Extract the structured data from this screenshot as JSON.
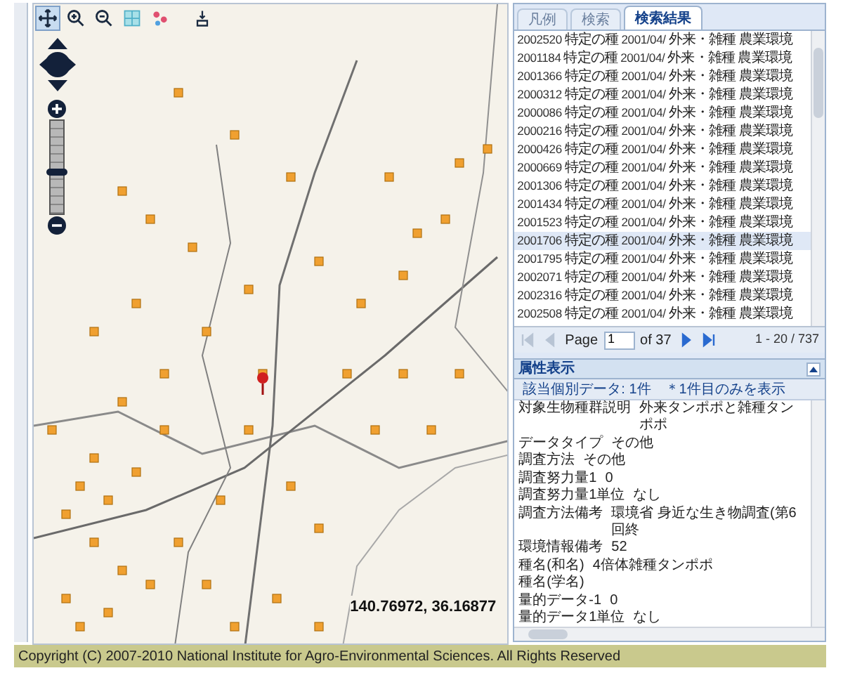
{
  "map_toolbar": {
    "tools": [
      {
        "kind": "pan",
        "selected": true
      },
      {
        "kind": "zoom_in",
        "selected": false
      },
      {
        "kind": "zoom_out",
        "selected": false
      },
      {
        "kind": "grid",
        "selected": false
      },
      {
        "kind": "points",
        "selected": false
      },
      {
        "kind": "print",
        "selected": false
      }
    ]
  },
  "zoom_slider": {
    "level": 0.45
  },
  "map": {
    "coordinates": "140.76972, 36.16877"
  },
  "tabs": [
    {
      "label": "凡例",
      "selected": false
    },
    {
      "label": "検索",
      "selected": false
    },
    {
      "label": "検索結果",
      "selected": true
    }
  ],
  "results": {
    "rows": [
      {
        "cells": [
          "2002520",
          "特定の種",
          "2001/04/",
          "外来・雑種",
          "農業環境"
        ],
        "selected": false
      },
      {
        "cells": [
          "2001184",
          "特定の種",
          "2001/04/",
          "外来・雑種",
          "農業環境"
        ],
        "selected": false
      },
      {
        "cells": [
          "2001366",
          "特定の種",
          "2001/04/",
          "外来・雑種",
          "農業環境"
        ],
        "selected": false
      },
      {
        "cells": [
          "2000312",
          "特定の種",
          "2001/04/",
          "外来・雑種",
          "農業環境"
        ],
        "selected": false
      },
      {
        "cells": [
          "2000086",
          "特定の種",
          "2001/04/",
          "外来・雑種",
          "農業環境"
        ],
        "selected": false
      },
      {
        "cells": [
          "2000216",
          "特定の種",
          "2001/04/",
          "外来・雑種",
          "農業環境"
        ],
        "selected": false
      },
      {
        "cells": [
          "2000426",
          "特定の種",
          "2001/04/",
          "外来・雑種",
          "農業環境"
        ],
        "selected": false
      },
      {
        "cells": [
          "2000669",
          "特定の種",
          "2001/04/",
          "外来・雑種",
          "農業環境"
        ],
        "selected": false
      },
      {
        "cells": [
          "2001306",
          "特定の種",
          "2001/04/",
          "外来・雑種",
          "農業環境"
        ],
        "selected": false
      },
      {
        "cells": [
          "2001434",
          "特定の種",
          "2001/04/",
          "外来・雑種",
          "農業環境"
        ],
        "selected": false
      },
      {
        "cells": [
          "2001523",
          "特定の種",
          "2001/04/",
          "外来・雑種",
          "農業環境"
        ],
        "selected": false
      },
      {
        "cells": [
          "2001706",
          "特定の種",
          "2001/04/",
          "外来・雑種",
          "農業環境"
        ],
        "selected": true
      },
      {
        "cells": [
          "2001795",
          "特定の種",
          "2001/04/",
          "外来・雑種",
          "農業環境"
        ],
        "selected": false
      },
      {
        "cells": [
          "2002071",
          "特定の種",
          "2001/04/",
          "外来・雑種",
          "農業環境"
        ],
        "selected": false
      },
      {
        "cells": [
          "2002316",
          "特定の種",
          "2001/04/",
          "外来・雑種",
          "農業環境"
        ],
        "selected": false
      },
      {
        "cells": [
          "2002508",
          "特定の種",
          "2001/04/",
          "外来・雑種",
          "農業環境"
        ],
        "selected": false
      }
    ]
  },
  "pager": {
    "buttons": [
      {
        "kind": "first",
        "disabled": true
      },
      {
        "kind": "prev",
        "disabled": true
      },
      {
        "kind": "next",
        "disabled": false
      },
      {
        "kind": "last",
        "disabled": false
      }
    ],
    "page_label": "Page",
    "page": "1",
    "of": "of 37",
    "range": "1 - 20 / 737"
  },
  "attributes": {
    "title": "属性表示",
    "summary": "該当個別データ: 1件",
    "note": "＊1件目のみを表示",
    "rows": [
      {
        "label": "対象生物種群説明",
        "value": "外来タンポポと雑種タンポポ"
      },
      {
        "label": "データタイプ",
        "value": "その他"
      },
      {
        "label": "調査方法",
        "value": "その他"
      },
      {
        "label": "調査努力量1",
        "value": "0"
      },
      {
        "label": "調査努力量1単位",
        "value": "なし"
      },
      {
        "label": "調査方法備考",
        "value": "環境省 身近な生き物調査(第6回終"
      },
      {
        "label": "環境情報備考",
        "value": "52"
      },
      {
        "label": "種名(和名)",
        "value": "4倍体雑種タンポポ"
      },
      {
        "label": "種名(学名)"
      },
      {
        "label": "量的データ-1",
        "value": "0"
      },
      {
        "label": "量的データ1単位",
        "value": "なし"
      }
    ]
  },
  "footer": "Copyright (C) 2007-2010 National Institute for Agro-Environmental Sciences. All Rights Reserved"
}
